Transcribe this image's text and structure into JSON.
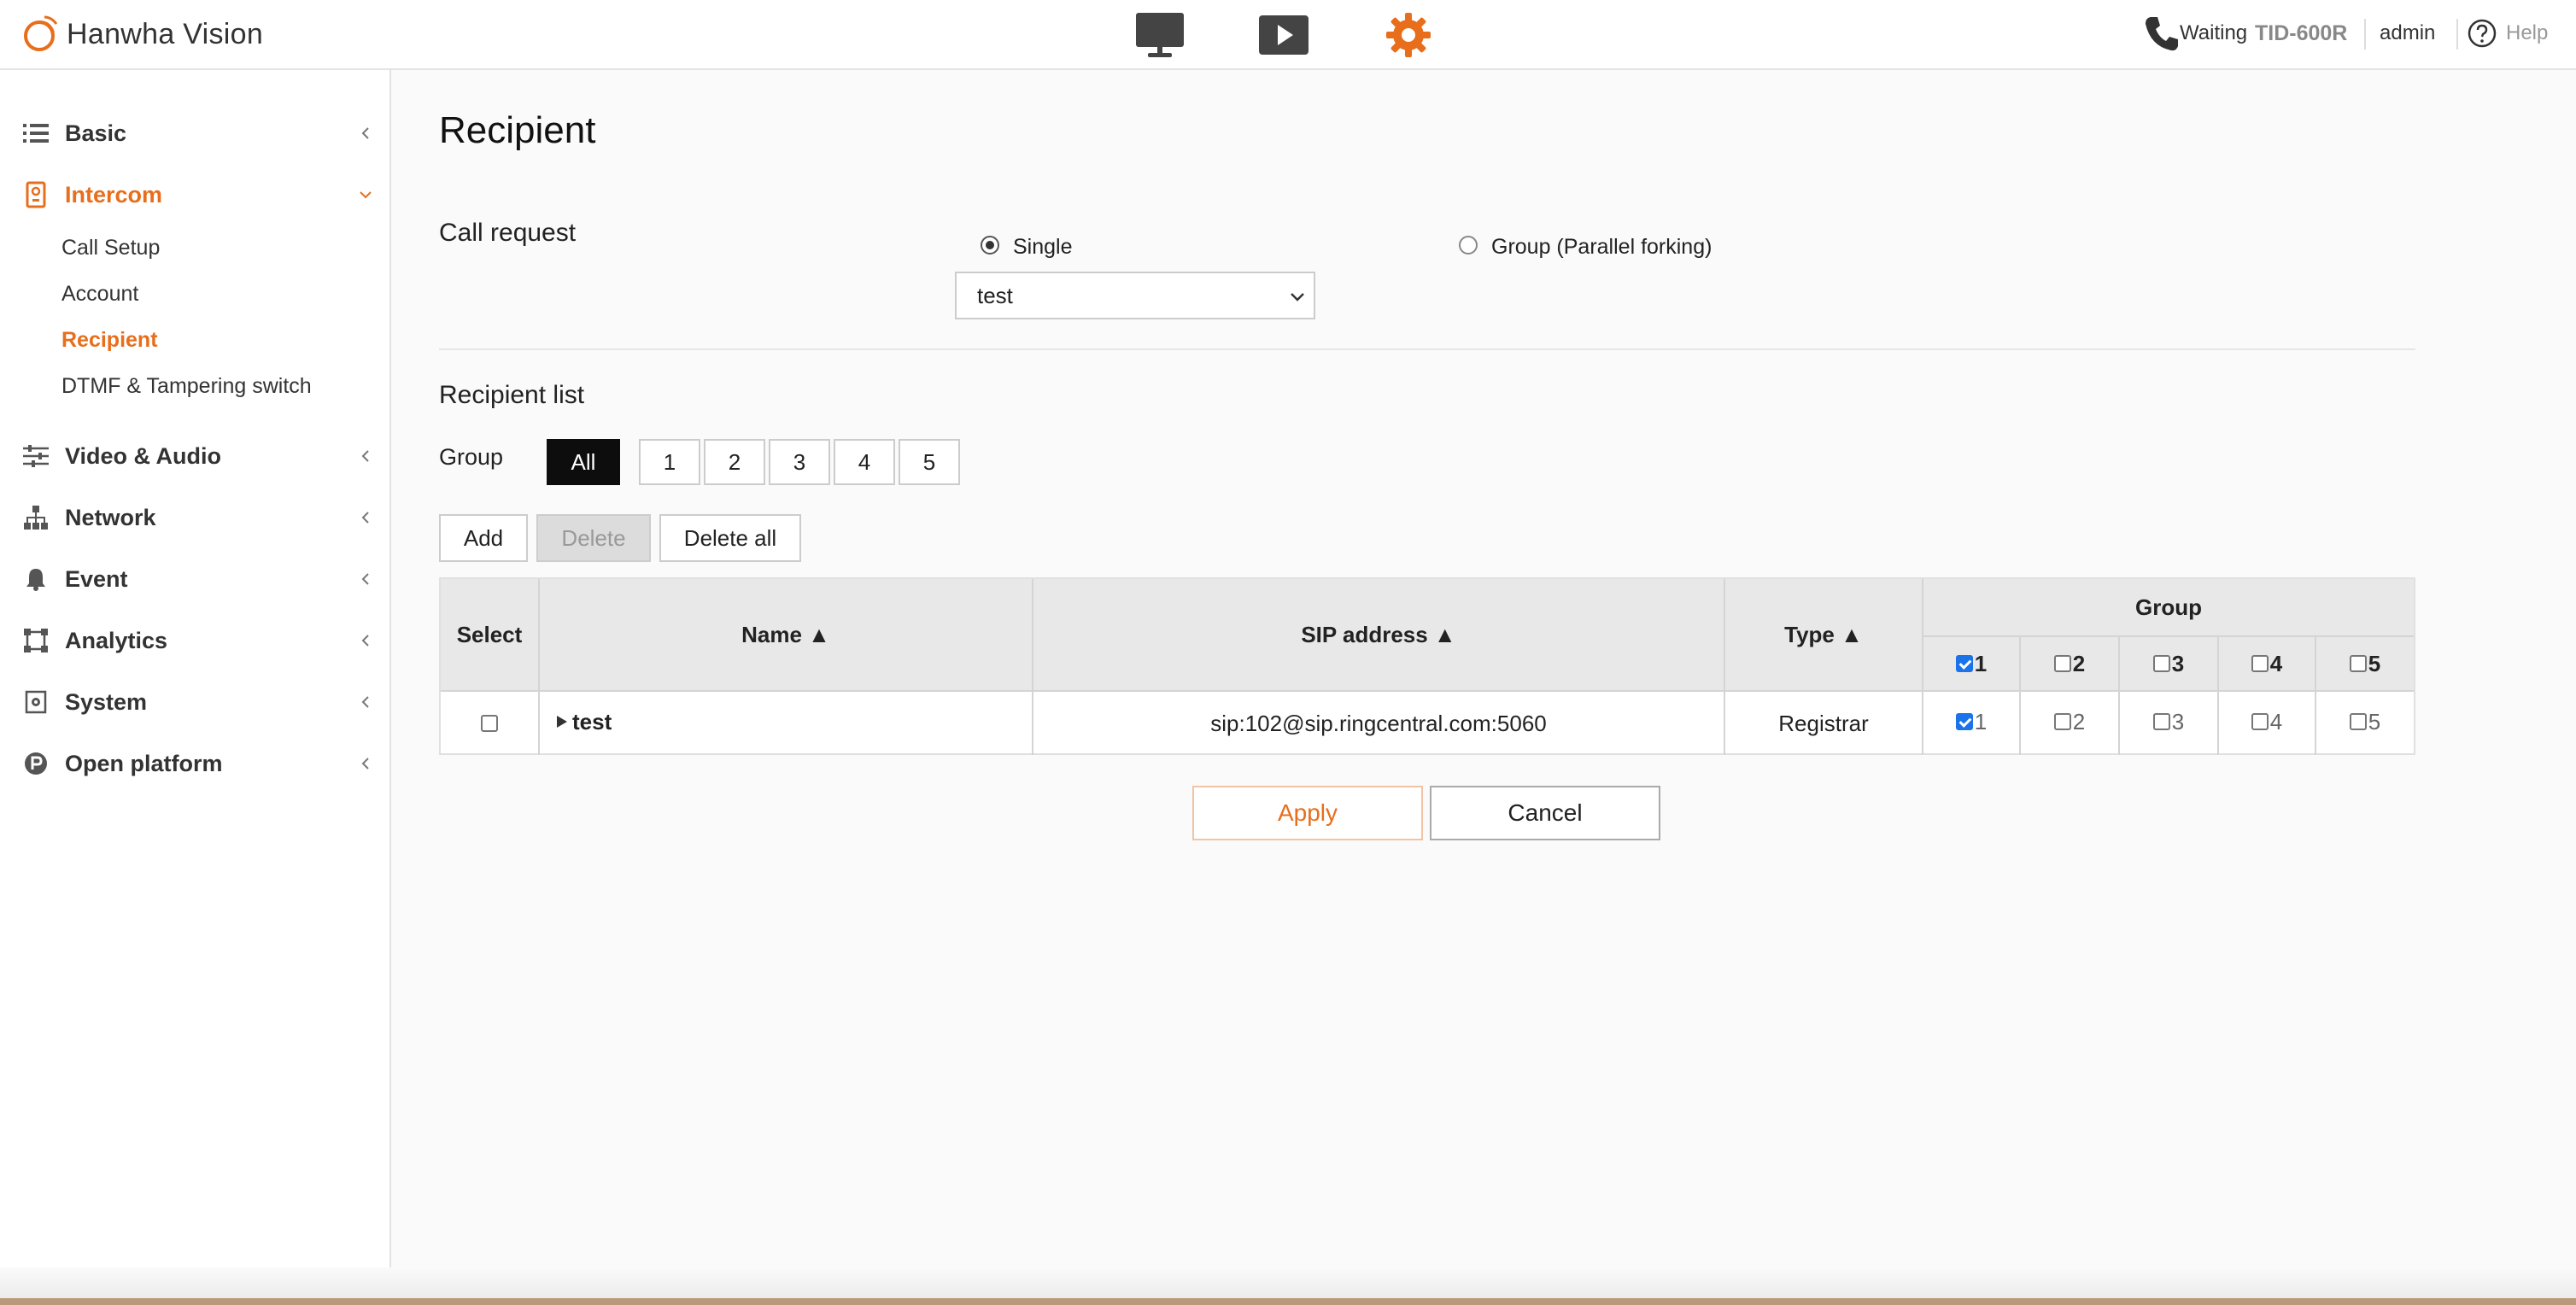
{
  "header": {
    "brand": "Hanwha Vision",
    "nav": [
      {
        "name": "monitor-icon"
      },
      {
        "name": "playback-icon"
      },
      {
        "name": "settings-icon",
        "active": true
      }
    ],
    "status": "Waiting",
    "model": "TID-600R",
    "user": "admin",
    "help": "Help",
    "accent_color": "#e86e1c"
  },
  "sidebar": {
    "items": [
      {
        "label": "Basic",
        "icon": "list-icon"
      },
      {
        "label": "Intercom",
        "icon": "intercom-icon",
        "expanded": true
      },
      {
        "label": "Video & Audio",
        "icon": "sliders-icon"
      },
      {
        "label": "Network",
        "icon": "network-icon"
      },
      {
        "label": "Event",
        "icon": "bell-icon"
      },
      {
        "label": "Analytics",
        "icon": "analytics-icon"
      },
      {
        "label": "System",
        "icon": "system-icon"
      },
      {
        "label": "Open platform",
        "icon": "open-platform-icon"
      }
    ],
    "intercom_sub": [
      "Call Setup",
      "Account",
      "Recipient",
      "DTMF & Tampering switch"
    ],
    "active_sub": "Recipient"
  },
  "main": {
    "title": "Recipient",
    "call_request": {
      "label": "Call request",
      "options": [
        "Single",
        "Group (Parallel forking)"
      ],
      "selected": "Single",
      "dropdown_value": "test"
    },
    "recipient_list": {
      "label": "Recipient list",
      "group_label": "Group",
      "group_buttons": [
        "All",
        "1",
        "2",
        "3",
        "4",
        "5"
      ],
      "active_group": "All",
      "actions": {
        "add": "Add",
        "delete": "Delete",
        "delete_all": "Delete all"
      }
    },
    "table": {
      "headers": {
        "select": "Select",
        "name": "Name ▲",
        "sip": "SIP address ▲",
        "type": "Type ▲",
        "group": "Group"
      },
      "group_header_nums": [
        "1",
        "2",
        "3",
        "4",
        "5"
      ],
      "group_header_checked": [
        true,
        false,
        false,
        false,
        false
      ],
      "rows": [
        {
          "name": "test",
          "sip": "sip:102@sip.ringcentral.com:5060",
          "type": "Registrar",
          "group_nums": [
            "1",
            "2",
            "3",
            "4",
            "5"
          ],
          "groups": [
            true,
            false,
            false,
            false,
            false
          ]
        }
      ]
    },
    "buttons": {
      "apply": "Apply",
      "cancel": "Cancel"
    }
  }
}
